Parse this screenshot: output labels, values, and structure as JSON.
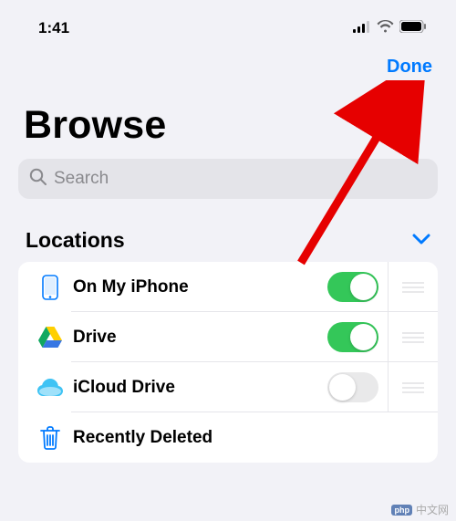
{
  "status": {
    "time": "1:41"
  },
  "nav": {
    "done": "Done"
  },
  "page": {
    "title": "Browse"
  },
  "search": {
    "placeholder": "Search"
  },
  "section": {
    "title": "Locations"
  },
  "rows": {
    "0": {
      "label": "On My iPhone",
      "toggle": true
    },
    "1": {
      "label": "Drive",
      "toggle": true
    },
    "2": {
      "label": "iCloud Drive",
      "toggle": false
    },
    "3": {
      "label": "Recently Deleted"
    }
  },
  "watermark": {
    "badge": "php",
    "text": "中文网"
  },
  "colors": {
    "accent": "#007aff",
    "toggleOn": "#34c759"
  }
}
